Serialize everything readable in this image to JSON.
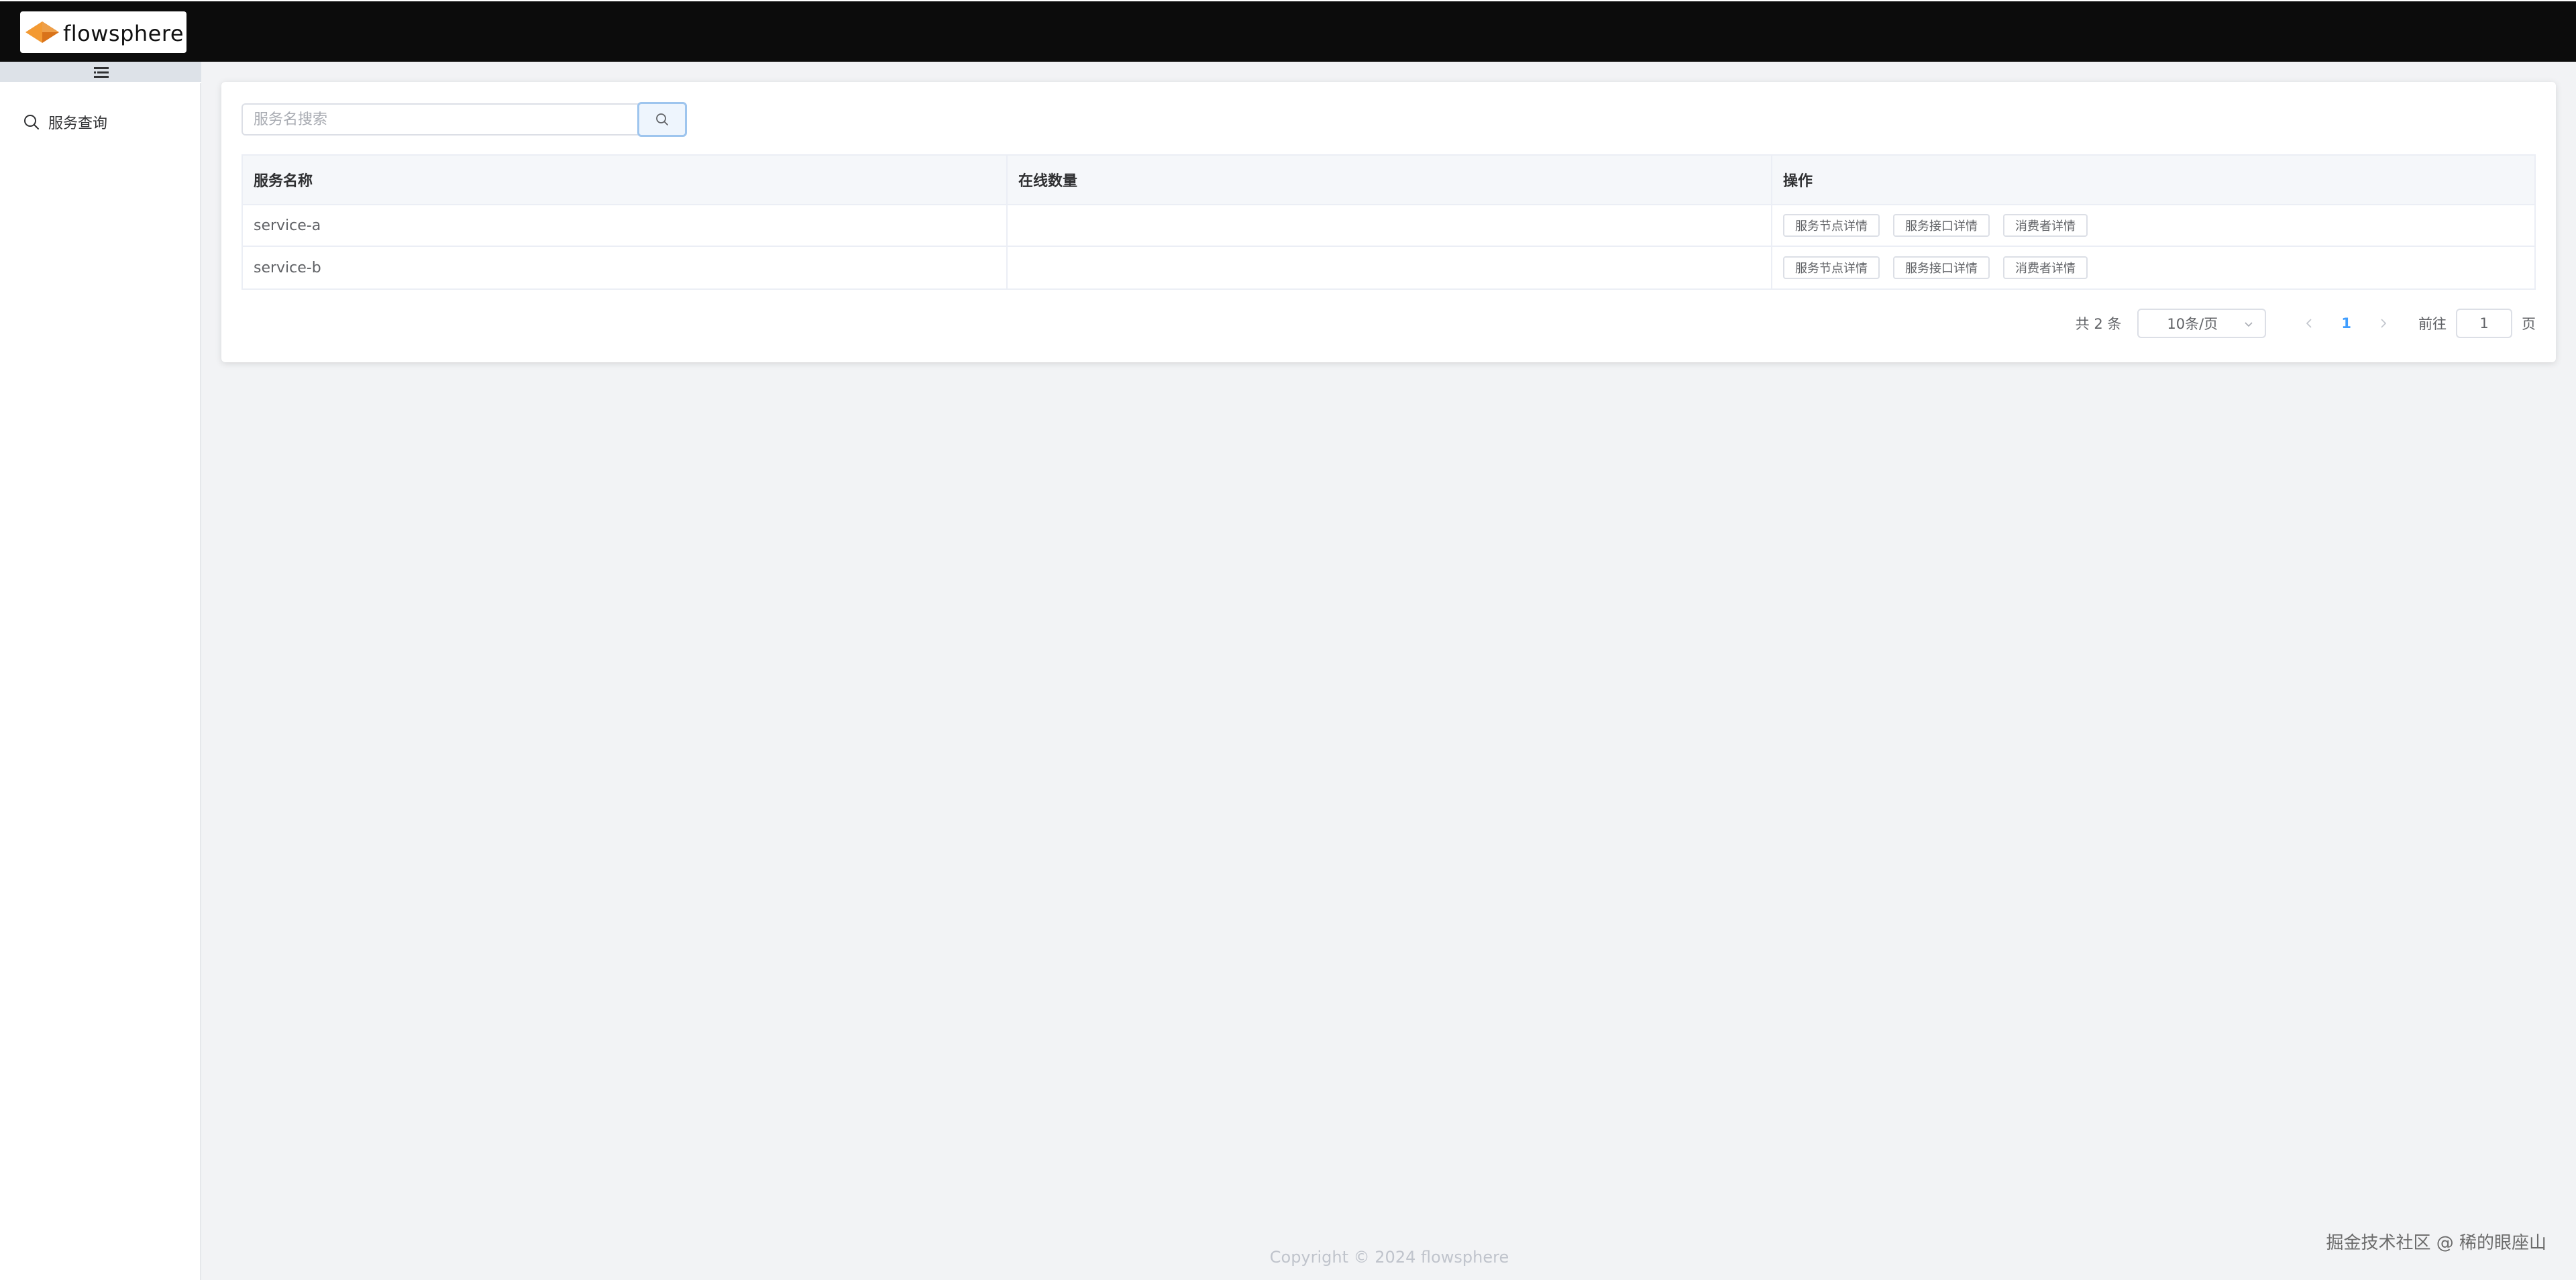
{
  "app": {
    "logo_text": "flowsphere"
  },
  "sidebar": {
    "toggle_icon": "hamburger-icon",
    "items": [
      {
        "label": "服务查询",
        "icon": "search-icon"
      }
    ]
  },
  "search": {
    "placeholder": "服务名搜索",
    "value": ""
  },
  "table": {
    "headers": [
      "服务名称",
      "在线数量",
      "操作"
    ],
    "rows": [
      {
        "name": "service-a",
        "online": "",
        "actions": [
          "服务节点详情",
          "服务接口详情",
          "消费者详情"
        ]
      },
      {
        "name": "service-b",
        "online": "",
        "actions": [
          "服务节点详情",
          "服务接口详情",
          "消费者详情"
        ]
      }
    ]
  },
  "pagination": {
    "total_text": "共 2 条",
    "page_size": "10条/页",
    "current_page": "1",
    "goto_label": "前往",
    "goto_value": "1",
    "goto_suffix": "页"
  },
  "footer": {
    "copyright": "Copyright © 2024 flowsphere"
  },
  "watermark": {
    "text": "掘金技术社区 @ 稀的眼座山"
  },
  "colors": {
    "topbar": "#0c0c0c",
    "accent": "#409eff",
    "logo_orange": "#f08a24"
  }
}
